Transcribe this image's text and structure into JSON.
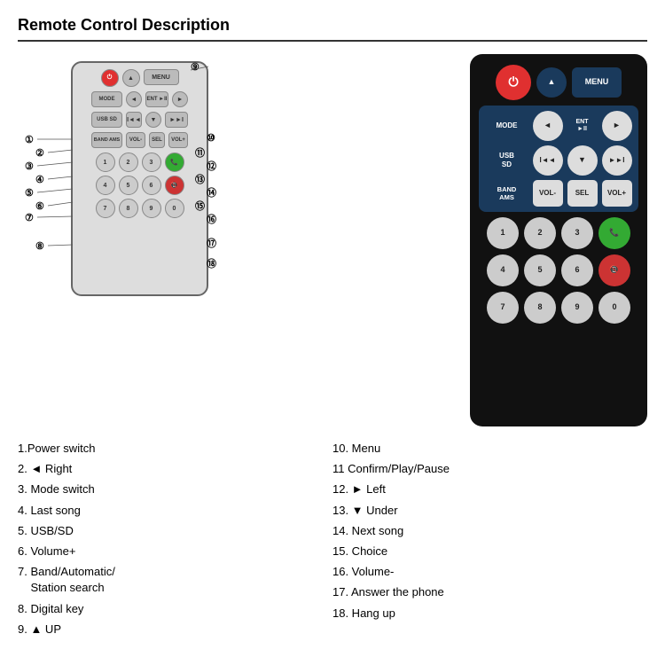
{
  "title": "Remote Control Description",
  "schematic": {
    "buttons": {
      "row1": [
        "⏻",
        "▲",
        "MENU"
      ],
      "row2": [
        "MODE",
        "◄",
        "ENT ►II",
        "►"
      ],
      "row3": [
        "USB SD",
        "I◄◄",
        "▼",
        "►►I"
      ],
      "row4": [
        "BAND AMS",
        "VOL-",
        "SEL",
        "VOL+"
      ],
      "row5_nums": [
        "1",
        "2",
        "3",
        "📞"
      ],
      "row6_nums": [
        "4",
        "5",
        "6",
        "📵"
      ],
      "row7_nums": [
        "7",
        "8",
        "9",
        "0"
      ]
    }
  },
  "real_remote": {
    "row1": [
      {
        "label": "⏻",
        "type": "power-r"
      },
      {
        "label": "▲",
        "type": "sm-r"
      },
      {
        "label": "MENU",
        "type": "med-r dark-blue"
      }
    ],
    "row2": [
      {
        "label": "MODE",
        "type": "wide-r dark-blue"
      },
      {
        "label": "◄",
        "type": "sm-r"
      },
      {
        "label": "ENT\n►II",
        "type": "sm-r dark-blue"
      },
      {
        "label": "►",
        "type": "sm-r"
      }
    ],
    "row3": [
      {
        "label": "USB\nSD",
        "type": "wide-r dark-blue"
      },
      {
        "label": "I◄◄",
        "type": "sm-r"
      },
      {
        "label": "▼",
        "type": "sm-r"
      },
      {
        "label": "►►I",
        "type": "sm-r"
      }
    ],
    "row4": [
      {
        "label": "BAND\nAMS",
        "type": "wide-r dark-blue"
      },
      {
        "label": "VOL-",
        "type": "sm-r"
      },
      {
        "label": "SEL",
        "type": "sm-r"
      },
      {
        "label": "VOL+",
        "type": "sm-r"
      }
    ],
    "row5": [
      {
        "label": "1",
        "type": "num-r"
      },
      {
        "label": "2",
        "type": "num-r"
      },
      {
        "label": "3",
        "type": "num-r"
      },
      {
        "label": "📞",
        "type": "green-r"
      }
    ],
    "row6": [
      {
        "label": "4",
        "type": "num-r"
      },
      {
        "label": "5",
        "type": "num-r"
      },
      {
        "label": "6",
        "type": "num-r"
      },
      {
        "label": "📵",
        "type": "red-r"
      }
    ],
    "row7": [
      {
        "label": "7",
        "type": "num-r"
      },
      {
        "label": "8",
        "type": "num-r"
      },
      {
        "label": "9",
        "type": "num-r"
      },
      {
        "label": "0",
        "type": "num-r"
      }
    ]
  },
  "descriptions": {
    "left": [
      {
        "num": "1",
        "text": "Power switch"
      },
      {
        "num": "2",
        "text": "◄ Right"
      },
      {
        "num": "3",
        "text": "Mode switch"
      },
      {
        "num": "4",
        "text": "Last song"
      },
      {
        "num": "5",
        "text": "USB/SD"
      },
      {
        "num": "6",
        "text": "Volume+"
      },
      {
        "num": "7",
        "text": "Band/Automatic/\n  Station search"
      },
      {
        "num": "8",
        "text": "Digital key"
      },
      {
        "num": "9",
        "text": "▲ UP"
      }
    ],
    "right": [
      {
        "num": "10",
        "text": "Menu"
      },
      {
        "num": "11",
        "text": "Confirm/Play/Pause"
      },
      {
        "num": "12",
        "text": "► Left"
      },
      {
        "num": "13",
        "text": "▼ Under"
      },
      {
        "num": "14",
        "text": "Next song"
      },
      {
        "num": "15",
        "text": "Choice"
      },
      {
        "num": "16",
        "text": "Volume-"
      },
      {
        "num": "17",
        "text": "Answer the phone"
      },
      {
        "num": "18",
        "text": "Hang up"
      }
    ]
  }
}
